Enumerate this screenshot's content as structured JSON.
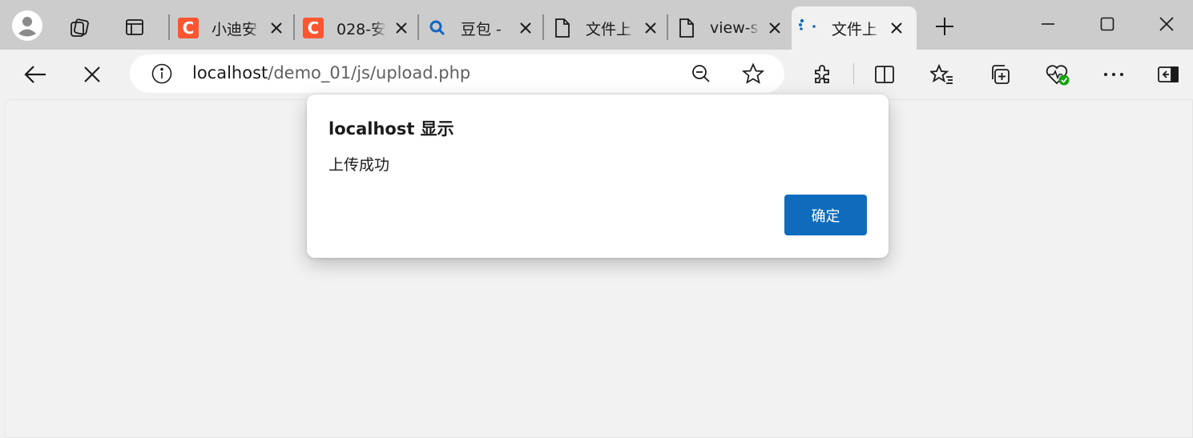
{
  "tabs": [
    {
      "title": "小迪安",
      "icon": "csdn-icon",
      "glyph": "C"
    },
    {
      "title": "028-安",
      "icon": "csdn-icon",
      "glyph": "C"
    },
    {
      "title": "豆包 -",
      "icon": "search-icon"
    },
    {
      "title": "文件上",
      "icon": "page-icon"
    },
    {
      "title": "view-s",
      "icon": "page-icon"
    },
    {
      "title": "文件上",
      "icon": "loading-icon",
      "active": true
    }
  ],
  "address": {
    "host": "localhost",
    "path": "/demo_01/js/upload.php"
  },
  "dialog": {
    "title": "localhost 显示",
    "message": "上传成功",
    "ok_label": "确定"
  },
  "colors": {
    "accent": "#0f6cbd",
    "csdn": "#fc5531",
    "tabbar": "#cccccc",
    "toolbar": "#f1f1f1"
  }
}
